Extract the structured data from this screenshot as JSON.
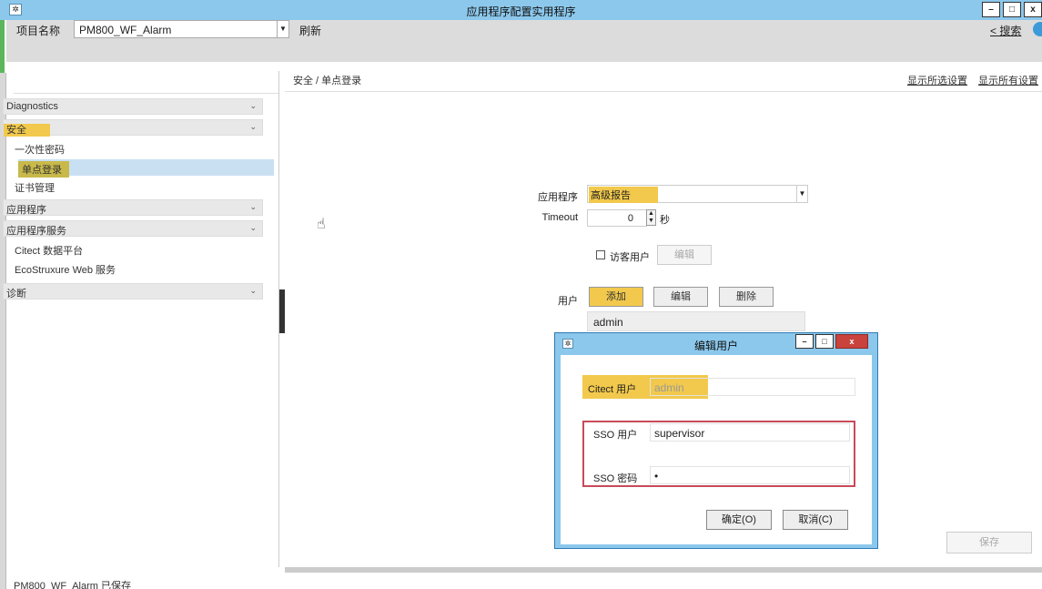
{
  "window": {
    "title": "应用程序配置实用程序",
    "sys_icon": "gear-icon",
    "min": "–",
    "max": "□",
    "close": "x"
  },
  "toolbar": {
    "project_label": "项目名称",
    "project_value": "PM800_WF_Alarm",
    "refresh": "刷新",
    "search": "< 搜索"
  },
  "sidebar": {
    "items": [
      {
        "label": "Diagnostics",
        "type": "group"
      },
      {
        "label": "安全",
        "type": "group"
      },
      {
        "label": "一次性密码",
        "type": "item"
      },
      {
        "label": "单点登录",
        "type": "item"
      },
      {
        "label": "证书管理",
        "type": "item"
      },
      {
        "label": "应用程序",
        "type": "group"
      },
      {
        "label": "应用程序服务",
        "type": "group"
      },
      {
        "label": "Citect 数据平台",
        "type": "item"
      },
      {
        "label": "EcoStruxure Web 服务",
        "type": "item"
      },
      {
        "label": "诊断",
        "type": "group"
      }
    ],
    "chevron": "⌄"
  },
  "main": {
    "breadcrumb": "安全 / 单点登录",
    "link_show_selected": "显示所选设置",
    "link_show_all": "显示所有设置",
    "app_label": "应用程序",
    "app_value": "高级报告",
    "timeout_label": "Timeout",
    "timeout_value": "0",
    "timeout_unit": "秒",
    "guest_label": "访客用户",
    "guest_edit": "编辑",
    "user_label": "用户",
    "add": "添加",
    "edit": "编辑",
    "delete": "删除",
    "users": [
      "admin"
    ],
    "save": "保存"
  },
  "dialog": {
    "title": "编辑用户",
    "citect_user_label": "Citect 用户",
    "citect_user_value": "admin",
    "sso_user_label": "SSO 用户",
    "sso_user_value": "supervisor",
    "sso_password_label": "SSO 密码",
    "sso_password_value": "•",
    "ok": "确定(O)",
    "cancel": "取消(C)"
  },
  "status": {
    "text": "PM800_WF_Alarm 已保存"
  }
}
